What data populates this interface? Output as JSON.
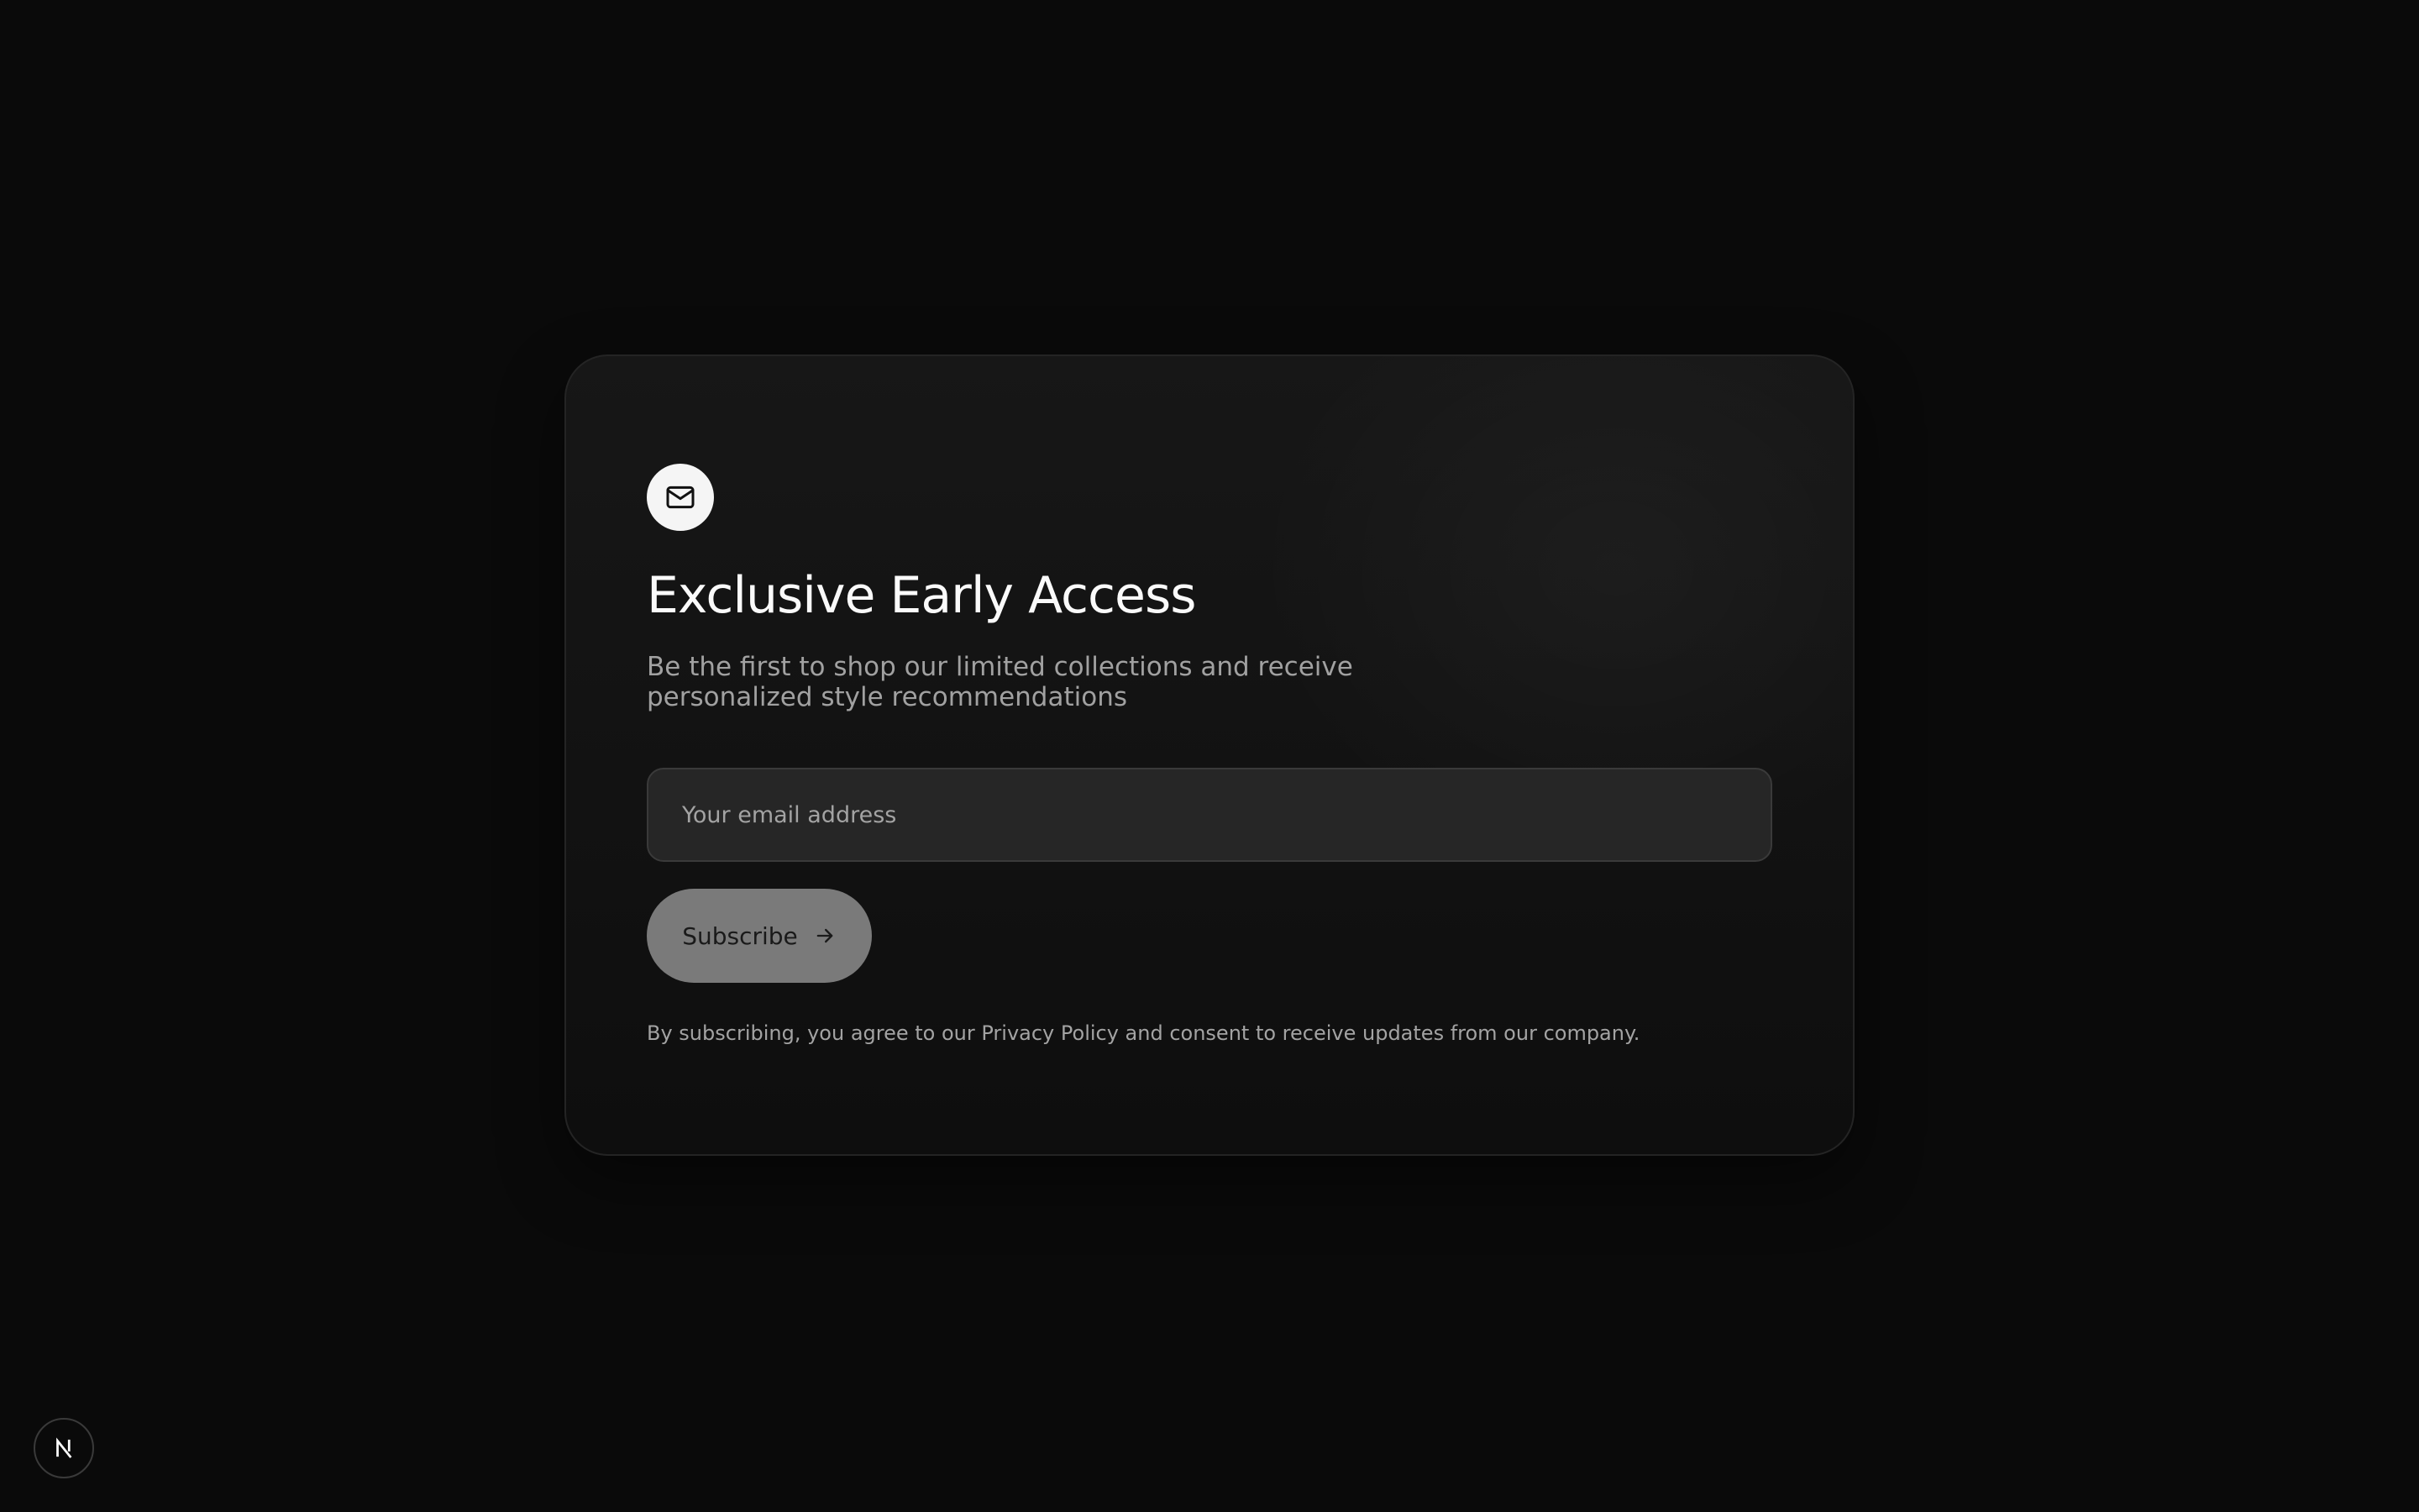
{
  "card": {
    "icon": "mail-icon",
    "title": "Exclusive Early Access",
    "subtitle": "Be the first to shop our limited collections and receive personalized style recommendations",
    "email_placeholder": "Your email address",
    "subscribe_label": "Subscribe",
    "subscribe_icon": "arrow-right-icon",
    "disclaimer": "By subscribing, you agree to our Privacy Policy and consent to receive updates from our company."
  },
  "dev_indicator": {
    "icon": "nextjs-logo-icon"
  },
  "colors": {
    "background": "#0a0a0a",
    "card": "#171717",
    "input": "#262626",
    "button": "#7a7a7a",
    "title": "#fafafa",
    "muted_text": "#a1a1a1"
  }
}
